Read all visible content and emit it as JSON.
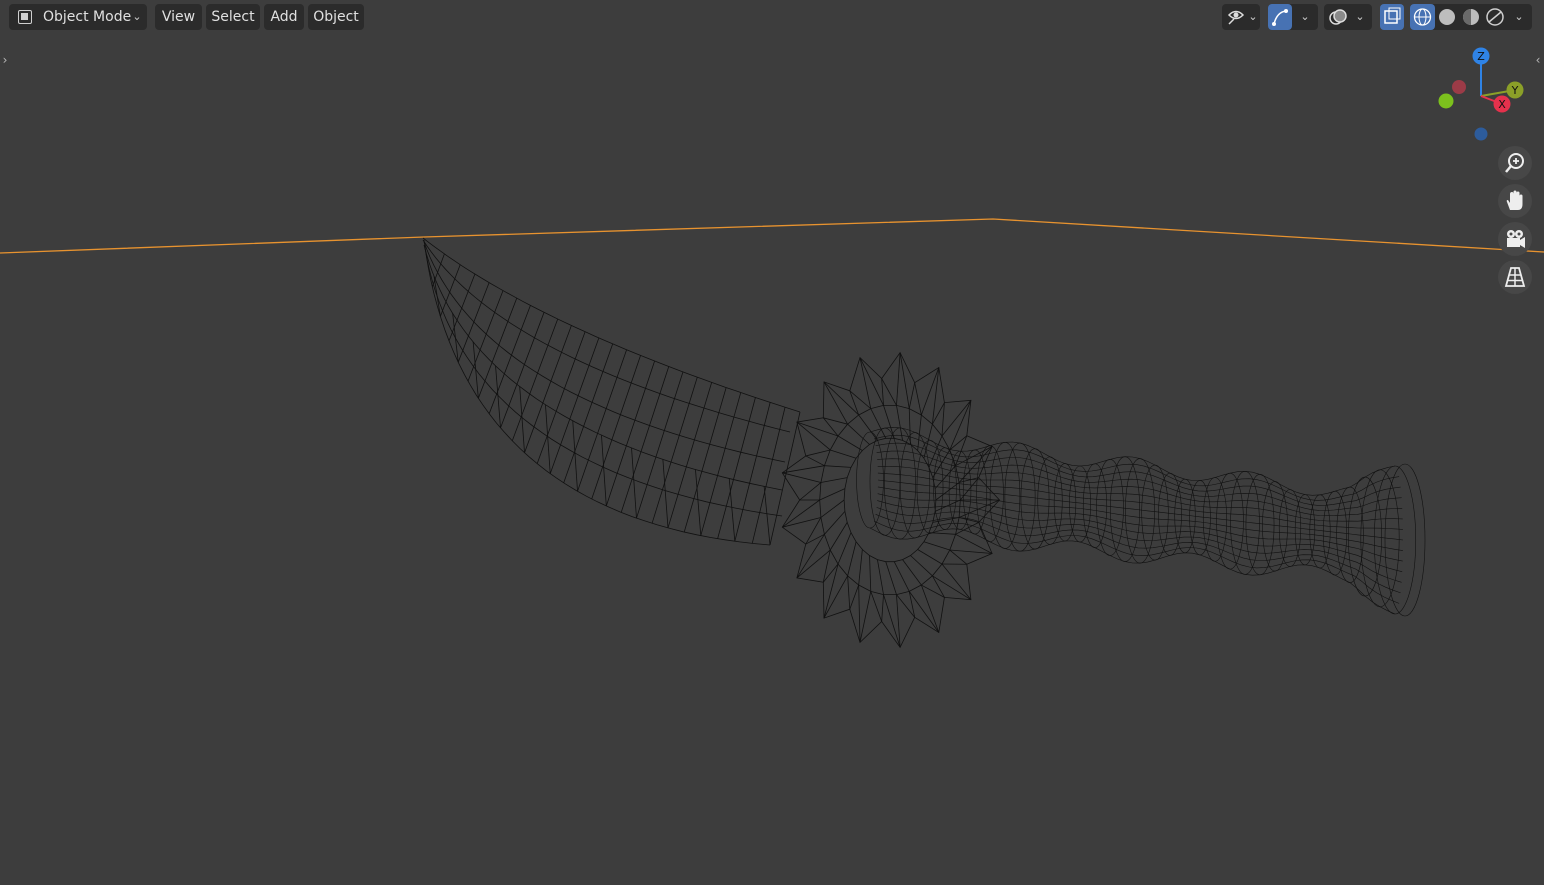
{
  "header": {
    "mode_label": "Object Mode",
    "menus": [
      "View",
      "Select",
      "Add",
      "Object"
    ]
  },
  "gizmo": {
    "axes": [
      "Z",
      "Y",
      "X"
    ],
    "colors": {
      "z": "#2f83e6",
      "y": "#8ba028",
      "x": "#e5314c"
    }
  },
  "icons": {
    "mode": "object-mode-icon",
    "visibility": "eye-icon",
    "gizmo_toggle": "gizmo-icon",
    "overlays": "overlay-icon",
    "xray": "xray-icon",
    "shading": [
      "wireframe-shading-icon",
      "solid-shading-icon",
      "material-shading-icon",
      "rendered-shading-icon"
    ],
    "nav": [
      "zoom-icon",
      "pan-hand-icon",
      "camera-icon",
      "grid-perspective-icon"
    ]
  },
  "colors": {
    "background": "#3d3d3d",
    "header_widget": "#2b2b2b",
    "accent": "#4772b3",
    "selection_outline": "#e8932f",
    "wire": "#111111"
  }
}
